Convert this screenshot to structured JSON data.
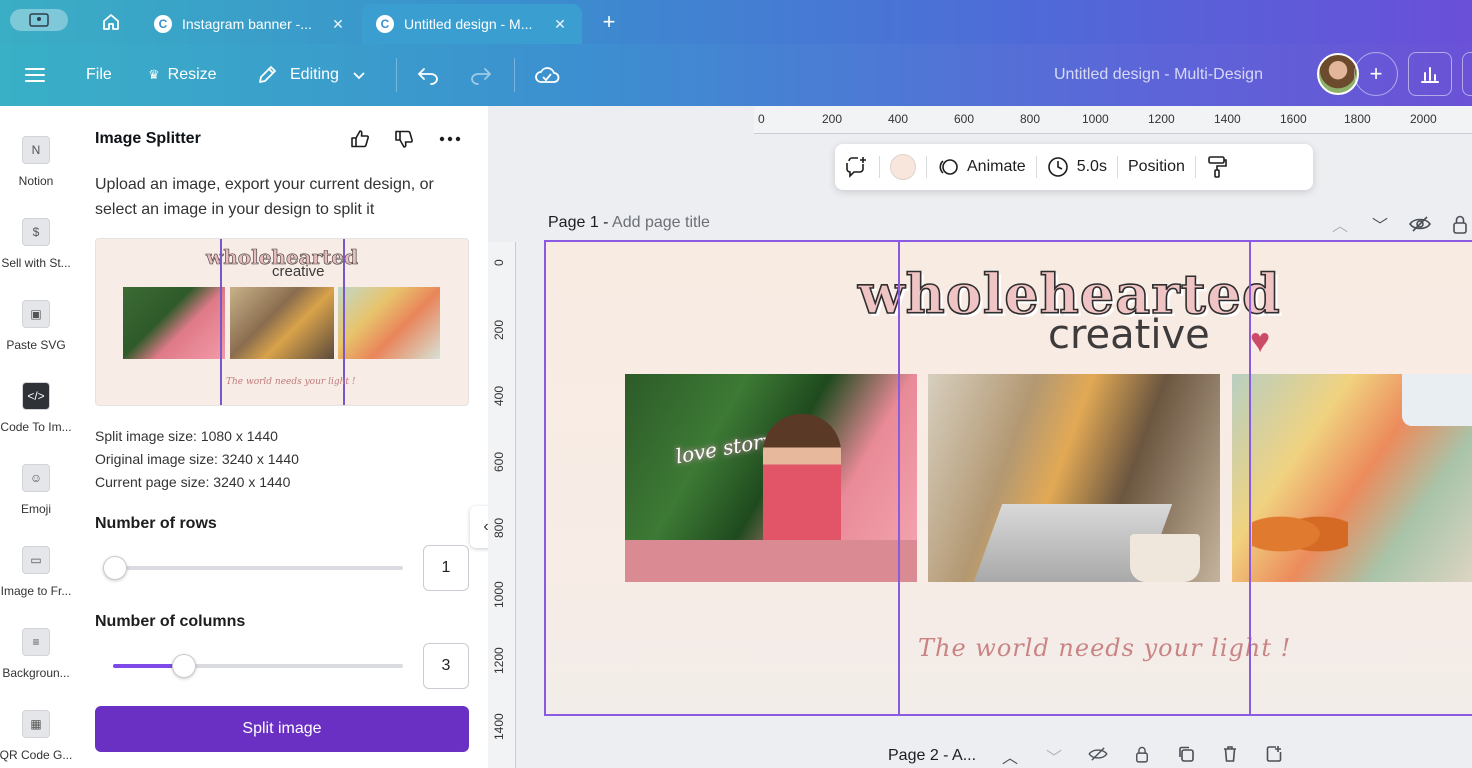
{
  "browser": {
    "tabs": [
      {
        "label": "Instagram banner -...",
        "active": false
      },
      {
        "label": "Untitled design - M...",
        "active": true
      }
    ],
    "favicon_letter": "C",
    "close_glyph": "✕",
    "new_tab_glyph": "+"
  },
  "toolbar": {
    "file_label": "File",
    "resize_label": "Resize",
    "editing_label": "Editing",
    "doc_title": "Untitled design - Multi-Design",
    "add_glyph": "+"
  },
  "rail": {
    "items": [
      {
        "label": "Notion",
        "icon": "notion-app-icon"
      },
      {
        "label": "Sell with St...",
        "icon": "sell-with-stripe-icon"
      },
      {
        "label": "Paste SVG",
        "icon": "paste-svg-icon"
      },
      {
        "label": "Code To Im...",
        "icon": "code-icon"
      },
      {
        "label": "Emoji",
        "icon": "emoji-icon"
      },
      {
        "label": "Image to Fr...",
        "icon": "image-frame-icon"
      },
      {
        "label": "Backgroun...",
        "icon": "background-icon"
      },
      {
        "label": "QR Code G...",
        "icon": "qr-code-icon"
      }
    ]
  },
  "panel": {
    "title": "Image Splitter",
    "description": "Upload an image, export your current design, or select an image in your design to split it",
    "split_size": "Split image size: 1080 x 1440",
    "original_size": "Original image size: 3240 x 1440",
    "page_size": "Current page size: 3240 x 1440",
    "rows_label": "Number of rows",
    "rows_value": "1",
    "columns_label": "Number of columns",
    "columns_value": "3",
    "split_button": "Split image"
  },
  "canvas": {
    "ruler_h": [
      "0",
      "200",
      "400",
      "600",
      "800",
      "1000",
      "1200",
      "1400",
      "1600",
      "1800",
      "2000"
    ],
    "ruler_v": [
      "0",
      "200",
      "400",
      "600",
      "800",
      "1000",
      "1200",
      "1400"
    ],
    "float_toolbar": {
      "animate_label": "Animate",
      "duration_label": "5.0s",
      "position_label": "Position"
    },
    "page1": {
      "prefix": "Page 1 - ",
      "placeholder": "Add page title"
    },
    "design": {
      "title": "wholehearted",
      "subtitle": "creative",
      "heart": "♥",
      "tagline": "The world needs your light !",
      "photo_neon": "love story"
    },
    "page2_label": "Page 2 - A..."
  },
  "colors": {
    "brand_purple": "#7d4ae8",
    "button_purple": "#6a30c3",
    "page_bg": "#f8ebe2",
    "title_pink": "#f0c4c4",
    "tagline_rose": "#c98484"
  }
}
